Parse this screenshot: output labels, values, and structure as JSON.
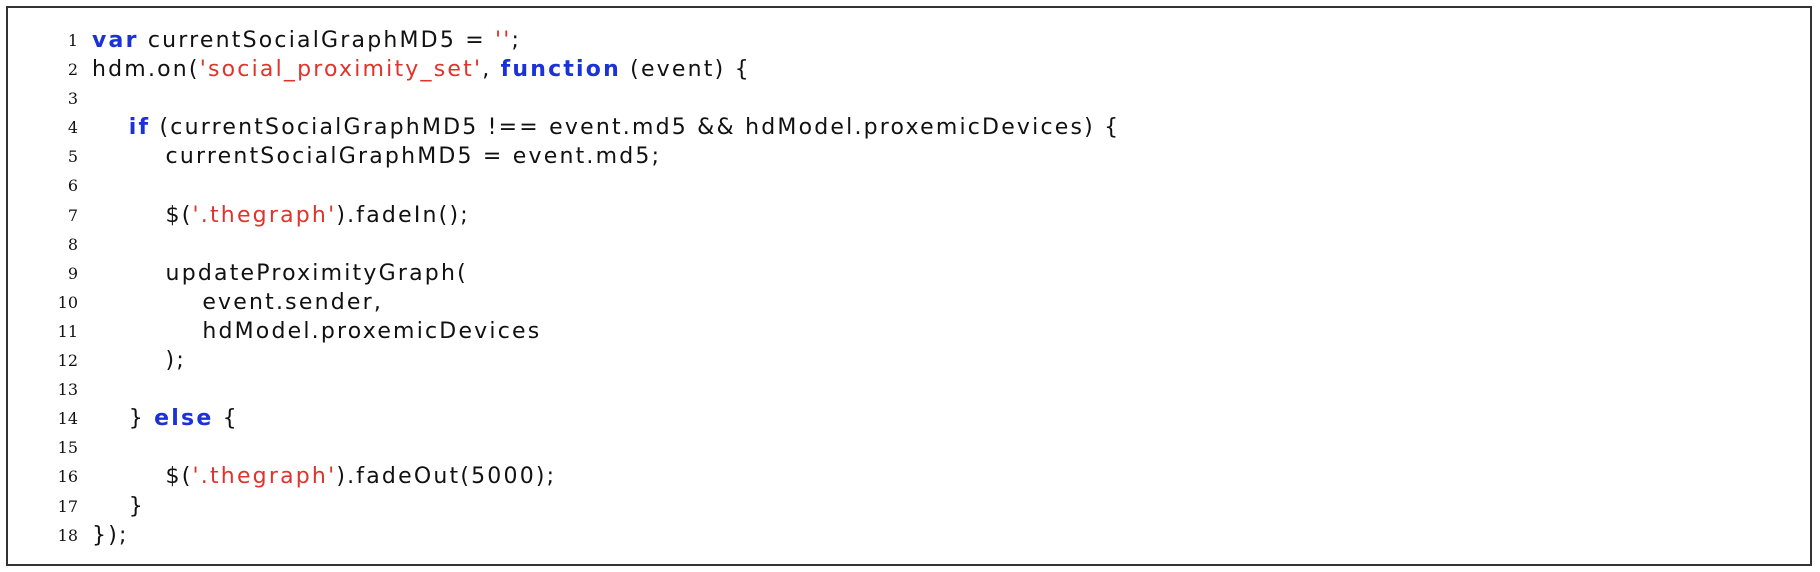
{
  "code_listing": {
    "lines": [
      {
        "no": "1",
        "segments": [
          {
            "t": "kw",
            "text": "var"
          },
          {
            "t": "plain",
            "text": " currentSocialGraphMD5 = "
          },
          {
            "t": "str",
            "text": "''"
          },
          {
            "t": "plain",
            "text": ";"
          }
        ]
      },
      {
        "no": "2",
        "segments": [
          {
            "t": "plain",
            "text": "hdm.on("
          },
          {
            "t": "str",
            "text": "'social_proximity_set'"
          },
          {
            "t": "plain",
            "text": ", "
          },
          {
            "t": "kw",
            "text": "function"
          },
          {
            "t": "plain",
            "text": " (event) {"
          }
        ]
      },
      {
        "no": "3",
        "segments": []
      },
      {
        "no": "4",
        "segments": [
          {
            "t": "plain",
            "text": "    "
          },
          {
            "t": "kw",
            "text": "if"
          },
          {
            "t": "plain",
            "text": " (currentSocialGraphMD5 !== event.md5 && hdModel.proxemicDevices) {"
          }
        ]
      },
      {
        "no": "5",
        "segments": [
          {
            "t": "plain",
            "text": "        currentSocialGraphMD5 = event.md5;"
          }
        ]
      },
      {
        "no": "6",
        "segments": []
      },
      {
        "no": "7",
        "segments": [
          {
            "t": "plain",
            "text": "        $("
          },
          {
            "t": "str",
            "text": "'.thegraph'"
          },
          {
            "t": "plain",
            "text": ").fadeIn();"
          }
        ]
      },
      {
        "no": "8",
        "segments": []
      },
      {
        "no": "9",
        "segments": [
          {
            "t": "plain",
            "text": "        updateProximityGraph("
          }
        ]
      },
      {
        "no": "10",
        "segments": [
          {
            "t": "plain",
            "text": "            event.sender,"
          }
        ]
      },
      {
        "no": "11",
        "segments": [
          {
            "t": "plain",
            "text": "            hdModel.proxemicDevices"
          }
        ]
      },
      {
        "no": "12",
        "segments": [
          {
            "t": "plain",
            "text": "        );"
          }
        ]
      },
      {
        "no": "13",
        "segments": []
      },
      {
        "no": "14",
        "segments": [
          {
            "t": "plain",
            "text": "    } "
          },
          {
            "t": "kw",
            "text": "else"
          },
          {
            "t": "plain",
            "text": " {"
          }
        ]
      },
      {
        "no": "15",
        "segments": []
      },
      {
        "no": "16",
        "segments": [
          {
            "t": "plain",
            "text": "        $("
          },
          {
            "t": "str",
            "text": "'.thegraph'"
          },
          {
            "t": "plain",
            "text": ").fadeOut(5000);"
          }
        ]
      },
      {
        "no": "17",
        "segments": [
          {
            "t": "plain",
            "text": "    }"
          }
        ]
      },
      {
        "no": "18",
        "segments": [
          {
            "t": "plain",
            "text": "});"
          }
        ]
      }
    ],
    "colors": {
      "keyword": "#1a32d8",
      "string": "#e0332b",
      "text": "#111111",
      "border": "#333333"
    }
  }
}
